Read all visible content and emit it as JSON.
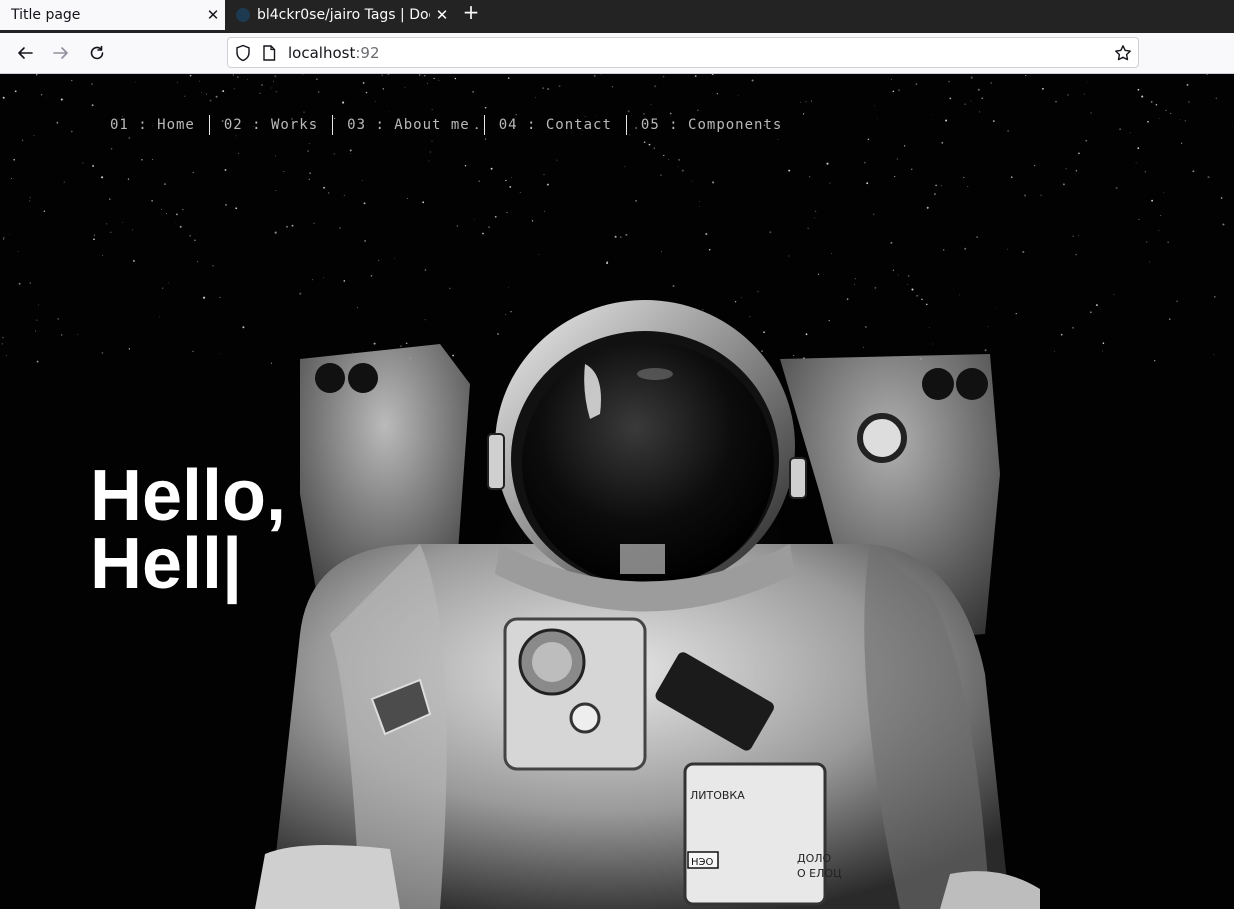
{
  "browser": {
    "tabs": [
      {
        "title": "Title page",
        "active": true
      },
      {
        "title": "bl4ckr0se/jairo Tags | Doc",
        "active": false
      }
    ],
    "url": {
      "host": "localhost",
      "port": ":92"
    }
  },
  "page": {
    "nav": [
      {
        "label": "01 : Home"
      },
      {
        "label": "02 : Works"
      },
      {
        "label": "03 : About me"
      },
      {
        "label": "04 : Contact"
      },
      {
        "label": "05 : Components"
      }
    ],
    "hero": {
      "line1": "Hello,",
      "line2": "Hell",
      "cursor": "|"
    },
    "astronaut_text": {
      "left_patch": "ЛИТОВКА",
      "tag1": "НЭО",
      "tag2": "ДОЛО",
      "tag3": "О ЕЛОЦ"
    }
  },
  "colors": {
    "background": "#020202",
    "text": "#ffffff",
    "nav_text": "#b9b9b9"
  }
}
